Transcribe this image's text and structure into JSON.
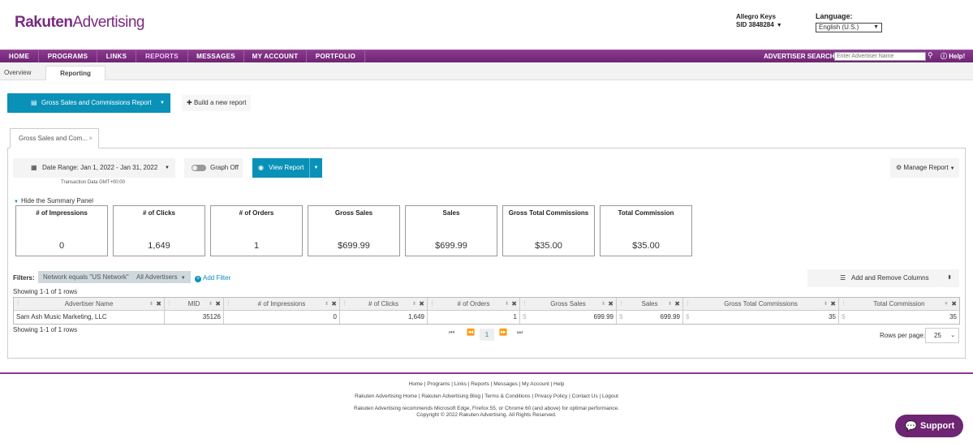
{
  "header": {
    "logo_brand": "Rakuten",
    "logo_product": "Advertising",
    "user_name": "Allegro Keys",
    "user_sid": "SID 3848284",
    "language_label": "Language:",
    "language_value": "English (U.S.)"
  },
  "nav": {
    "items": [
      "HOME",
      "PROGRAMS",
      "LINKS",
      "REPORTS",
      "MESSAGES",
      "MY ACCOUNT",
      "PORTFOLIO"
    ],
    "active": "REPORTS",
    "advertiser_search_label": "ADVERTISER SEARCH:",
    "advertiser_search_placeholder": "Enter Advertiser Name",
    "help": "Help!"
  },
  "subtabs": [
    "Overview",
    "Reporting"
  ],
  "toolbar": {
    "report_name": "Gross Sales and Commissions Report",
    "build_report": "Build a new report"
  },
  "report": {
    "tab_label": "Gross Sales and Com...",
    "date_range": "Date Range: Jan 1, 2022 - Jan 31, 2022",
    "timezone_note": "Transaction Data GMT+00:00",
    "graph_label": "Graph Off",
    "view_report": "View Report",
    "manage_report": "Manage Report",
    "hide_summary": "Hide the Summary Panel"
  },
  "summary": [
    {
      "title": "# of Impressions",
      "value": "0"
    },
    {
      "title": "# of Clicks",
      "value": "1,649"
    },
    {
      "title": "# of Orders",
      "value": "1"
    },
    {
      "title": "Gross Sales",
      "value": "$699.99"
    },
    {
      "title": "Sales",
      "value": "$699.99"
    },
    {
      "title": "Gross Total Commissions",
      "value": "$35.00"
    },
    {
      "title": "Total Commission",
      "value": "$35.00"
    }
  ],
  "filters": {
    "label": "Filters:",
    "network": "Network equals \"US Network\"",
    "advertisers": "All Advertisers",
    "add_filter": "Add Filter",
    "columns_button": "Add and Remove Columns"
  },
  "table": {
    "showing_top": "Showing 1-1 of 1 rows",
    "showing_bottom": "Showing 1-1 of 1 rows",
    "columns": [
      "Advertiser Name",
      "MID",
      "# of Impressions",
      "# of Clicks",
      "# of Orders",
      "Gross Sales",
      "Sales",
      "Gross Total Commissions",
      "Total Commission"
    ],
    "rows": [
      [
        "Sam Ash Music Marketing, LLC",
        "35126",
        "0",
        "1,649",
        "1",
        "699.99",
        "699.99",
        "35",
        "35"
      ]
    ],
    "currency_symbol": "$"
  },
  "pager": {
    "current_page": "1",
    "rows_per_page_label": "Rows per page:",
    "rows_per_page": "25"
  },
  "footer": {
    "links_line": "Home | Programs | Links | Reports | Messages | My Account | Help",
    "links_line2": "Rakuten Advertising Home | Rakuten Advertising Blog | Terms & Conditions | Privacy Policy | Contact Us | Logout",
    "recommend": "Rakuten Advertising recommends Microsoft Edge, Firefox 55, or Chrome 60 (and above) for optimal performance.",
    "copyright": "Copyright © 2022 Rakuten Advertising. All Rights Reserved.",
    "support": "Support"
  },
  "colors": {
    "brand_purple": "#7b2a82",
    "accent_blue": "#0a91b8"
  }
}
